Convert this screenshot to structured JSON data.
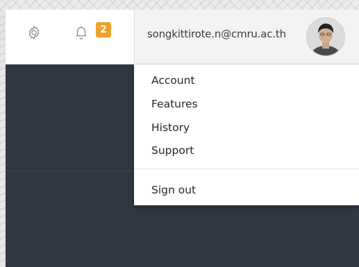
{
  "header": {
    "notification_count": "2",
    "user_email": "songkittirote.n@cmru.ac.th",
    "colors": {
      "badge": "#f0a12c",
      "dark_panel": "#303642",
      "topbar": "#ffffff"
    },
    "icons": {
      "settings": "gear-icon",
      "notifications": "bell-icon",
      "avatar": "avatar"
    }
  },
  "user_menu": {
    "items": [
      {
        "label": "Account"
      },
      {
        "label": "Features"
      },
      {
        "label": "History"
      },
      {
        "label": "Support"
      }
    ],
    "sign_out_label": "Sign out"
  }
}
